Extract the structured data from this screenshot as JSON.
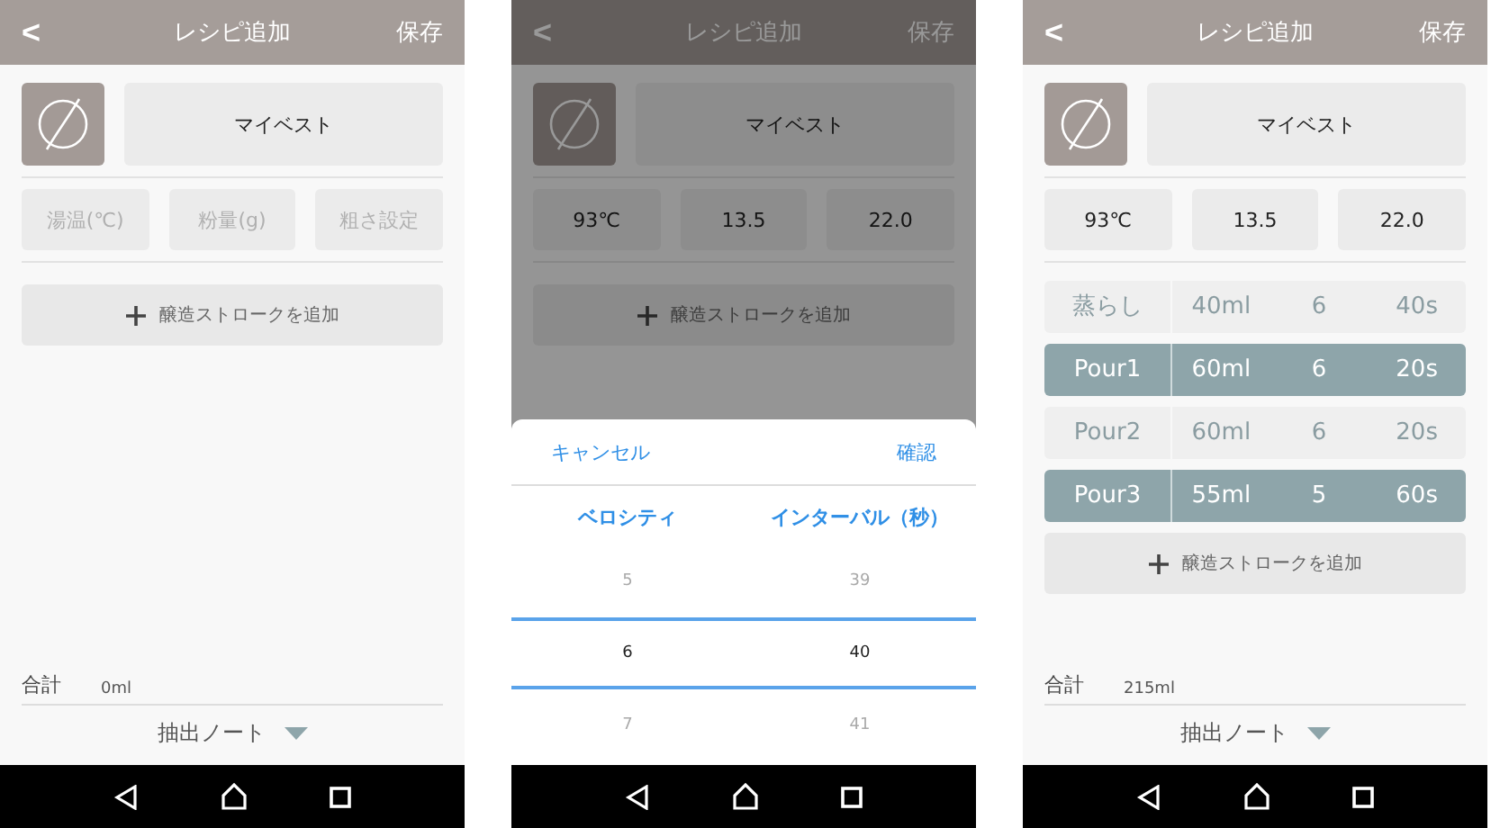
{
  "screens": [
    {
      "header": {
        "back": "<",
        "title": "レシピ追加",
        "save": "保存"
      },
      "recipe_name": "マイベスト",
      "params": [
        {
          "placeholder": "湯温(℃)"
        },
        {
          "placeholder": "粉量(g)"
        },
        {
          "placeholder": "粗さ設定"
        }
      ],
      "add_stroke": "醸造ストロークを追加",
      "total": {
        "label": "合計",
        "value": "0ml"
      },
      "note": "抽出ノート",
      "dimmed": false
    },
    {
      "header": {
        "back": "<",
        "title": "レシピ追加",
        "save": "保存"
      },
      "recipe_name": "マイベスト",
      "params": [
        {
          "value": "93℃"
        },
        {
          "value": "13.5"
        },
        {
          "value": "22.0"
        }
      ],
      "add_stroke": "醸造ストロークを追加",
      "dimmed": true,
      "picker": {
        "cancel": "キャンセル",
        "confirm": "確認",
        "columns": [
          {
            "heading": "ベロシティ",
            "options": [
              {
                "label": "5",
                "selected": false
              },
              {
                "label": "6",
                "selected": true
              },
              {
                "label": "7",
                "selected": false
              }
            ]
          },
          {
            "heading": "インターバル（秒）",
            "options": [
              {
                "label": "39",
                "selected": false
              },
              {
                "label": "40",
                "selected": true
              },
              {
                "label": "41",
                "selected": false
              }
            ]
          }
        ]
      }
    },
    {
      "header": {
        "back": "<",
        "title": "レシピ追加",
        "save": "保存"
      },
      "recipe_name": "マイベスト",
      "params": [
        {
          "value": "93℃"
        },
        {
          "value": "13.5"
        },
        {
          "value": "22.0"
        }
      ],
      "strokes": [
        {
          "name": "蒸らし",
          "volume": "40ml",
          "velocity": "6",
          "interval": "40s",
          "highlighted": false
        },
        {
          "name": "Pour1",
          "volume": "60ml",
          "velocity": "6",
          "interval": "20s",
          "highlighted": true
        },
        {
          "name": "Pour2",
          "volume": "60ml",
          "velocity": "6",
          "interval": "20s",
          "highlighted": false
        },
        {
          "name": "Pour3",
          "volume": "55ml",
          "velocity": "5",
          "interval": "60s",
          "highlighted": true
        }
      ],
      "add_stroke": "醸造ストロークを追加",
      "total": {
        "label": "合計",
        "value": "215ml"
      },
      "note": "抽出ノート",
      "dimmed": false
    }
  ]
}
